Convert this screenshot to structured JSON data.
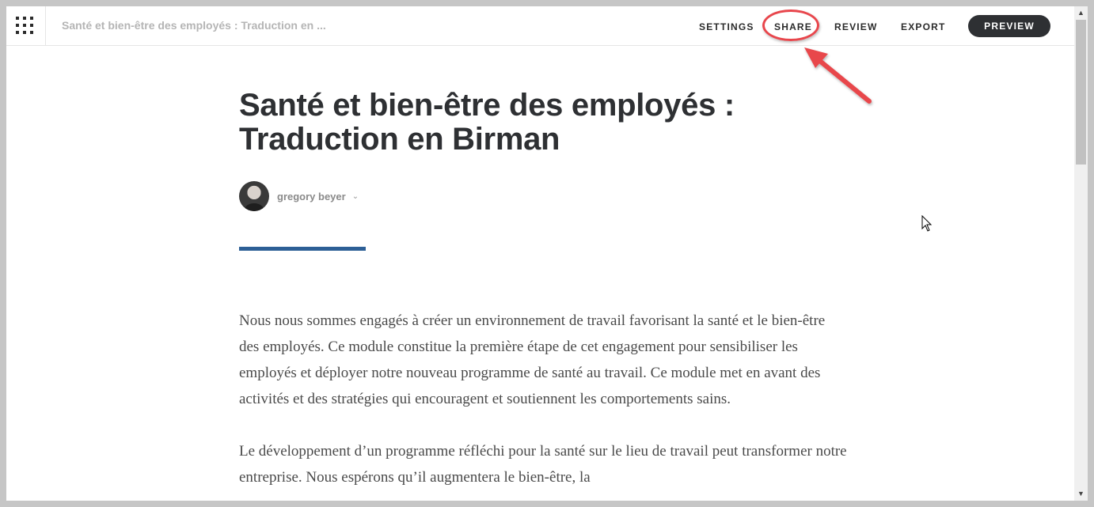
{
  "topbar": {
    "doc_title": "Santé et bien-être des employés : Traduction en ...",
    "nav": {
      "settings": "SETTINGS",
      "share": "SHARE",
      "review": "REVIEW",
      "export": "EXPORT",
      "preview": "PREVIEW"
    },
    "menu_icon": "grid-menu-icon"
  },
  "article": {
    "title": "Santé et bien-être des employés : Traduction en Birman",
    "author": "gregory beyer",
    "paragraphs": [
      "Nous nous sommes engagés à créer un environnement de travail favorisant la santé et le bien-être des employés. Ce module constitue la première étape de cet engagement pour sensibiliser les employés et déployer notre nouveau programme de santé au travail. Ce module met en avant des activités et des stratégies qui encouragent et soutiennent les comportements sains.",
      "Le développement d’un programme réfléchi pour la santé sur le lieu de travail peut transformer notre entreprise. Nous espérons qu’il augmentera le bien-être, la"
    ]
  },
  "colors": {
    "accent_divider": "#2d5f96",
    "preview_button": "#2e3033",
    "annotation_red": "#e8464c"
  }
}
